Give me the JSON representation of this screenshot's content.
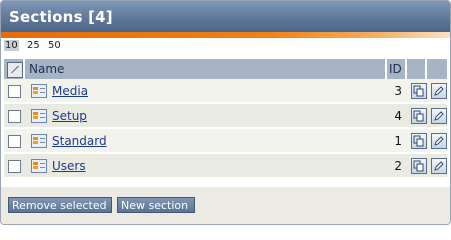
{
  "panel": {
    "title": "Sections [4]"
  },
  "pager": {
    "options": [
      "10",
      "25",
      "50"
    ],
    "selected": "10"
  },
  "table": {
    "headers": {
      "name": "Name",
      "id": "ID"
    },
    "rows": [
      {
        "name": "Media",
        "id": "3"
      },
      {
        "name": "Setup",
        "id": "4"
      },
      {
        "name": "Standard",
        "id": "1"
      },
      {
        "name": "Users",
        "id": "2"
      }
    ]
  },
  "buttons": {
    "remove_selected": "Remove selected",
    "new_section": "New section"
  },
  "icons": {
    "row_icon": "section-icon",
    "copy": "copy-icon",
    "edit": "edit-icon",
    "select_all": "select-all-icon"
  },
  "colors": {
    "titlebar": "#60799a",
    "accent": "#ee8316",
    "header": "#a7b4c6",
    "link": "#1a3a8a"
  }
}
